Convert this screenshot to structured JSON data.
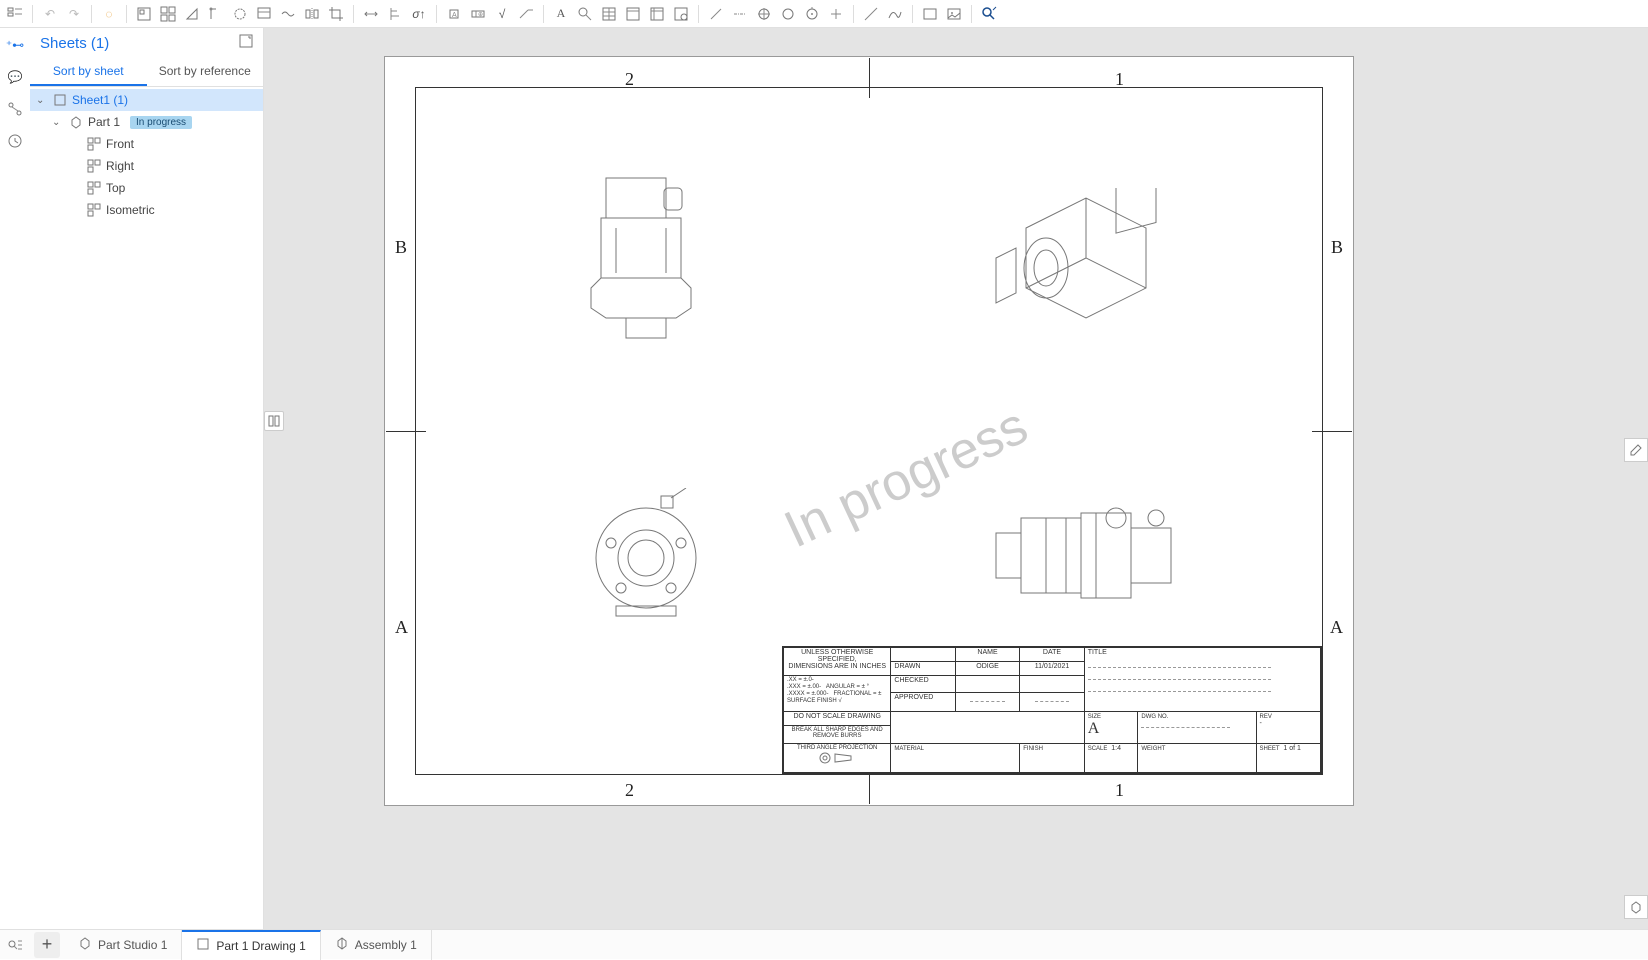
{
  "panel": {
    "title": "Sheets (1)",
    "sort_tabs": [
      "Sort by sheet",
      "Sort by reference"
    ],
    "active_sort": 0,
    "tree": {
      "sheet": {
        "label": "Sheet1 (1)"
      },
      "part": {
        "label": "Part 1",
        "badge": "In progress"
      },
      "views": [
        "Front",
        "Right",
        "Top",
        "Isometric"
      ]
    }
  },
  "canvas": {
    "watermark": "In progress",
    "zones": {
      "cols": [
        "2",
        "1"
      ],
      "rows": [
        "B",
        "A"
      ]
    }
  },
  "title_block": {
    "notes_line1": "UNLESS OTHERWISE SPECIFIED,",
    "notes_line2": "DIMENSIONS ARE IN INCHES",
    "tol_xx": ".XX = ±.0-",
    "tol_xxx": ".XXX = ±.00-",
    "tol_xxxx": ".XXXX = ±.000-",
    "tol_ang": "ANGULAR = ± °",
    "tol_frac": "FRACTIONAL = ±",
    "surface": "SURFACE FINISH",
    "no_scale": "DO NOT SCALE DRAWING",
    "break_edges": "BREAK ALL SHARP EDGES AND REMOVE BURRS",
    "projection": "THIRD ANGLE PROJECTION",
    "hdr_name": "NAME",
    "hdr_date": "DATE",
    "drawn_lbl": "DRAWN",
    "drawn_name": "ODIGE",
    "drawn_date": "11/01/2021",
    "checked_lbl": "CHECKED",
    "approved_lbl": "APPROVED",
    "material_lbl": "MATERIAL",
    "finish_lbl": "FINISH",
    "title_lbl": "TITLE",
    "size_lbl": "SIZE",
    "size_val": "A",
    "dwg_lbl": "DWG NO.",
    "rev_lbl": "REV",
    "scale_lbl": "SCALE",
    "scale_val": "1:4",
    "weight_lbl": "WEIGHT",
    "sheet_lbl": "SHEET",
    "sheet_val": "1 of 1"
  },
  "bottom_tabs": [
    {
      "label": "Part Studio 1"
    },
    {
      "label": "Part 1 Drawing 1"
    },
    {
      "label": "Assembly 1"
    }
  ],
  "active_bottom_tab": 1
}
